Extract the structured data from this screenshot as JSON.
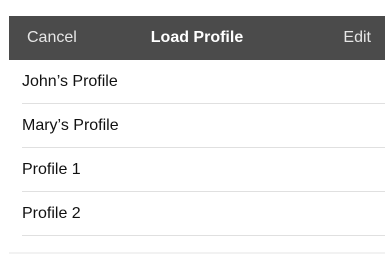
{
  "navbar": {
    "cancel_label": "Cancel",
    "title": "Load Profile",
    "edit_label": "Edit",
    "background_color": "#4b4b4b"
  },
  "profiles": [
    {
      "name": "John’s Profile"
    },
    {
      "name": "Mary’s Profile"
    },
    {
      "name": "Profile 1"
    },
    {
      "name": "Profile 2"
    }
  ]
}
